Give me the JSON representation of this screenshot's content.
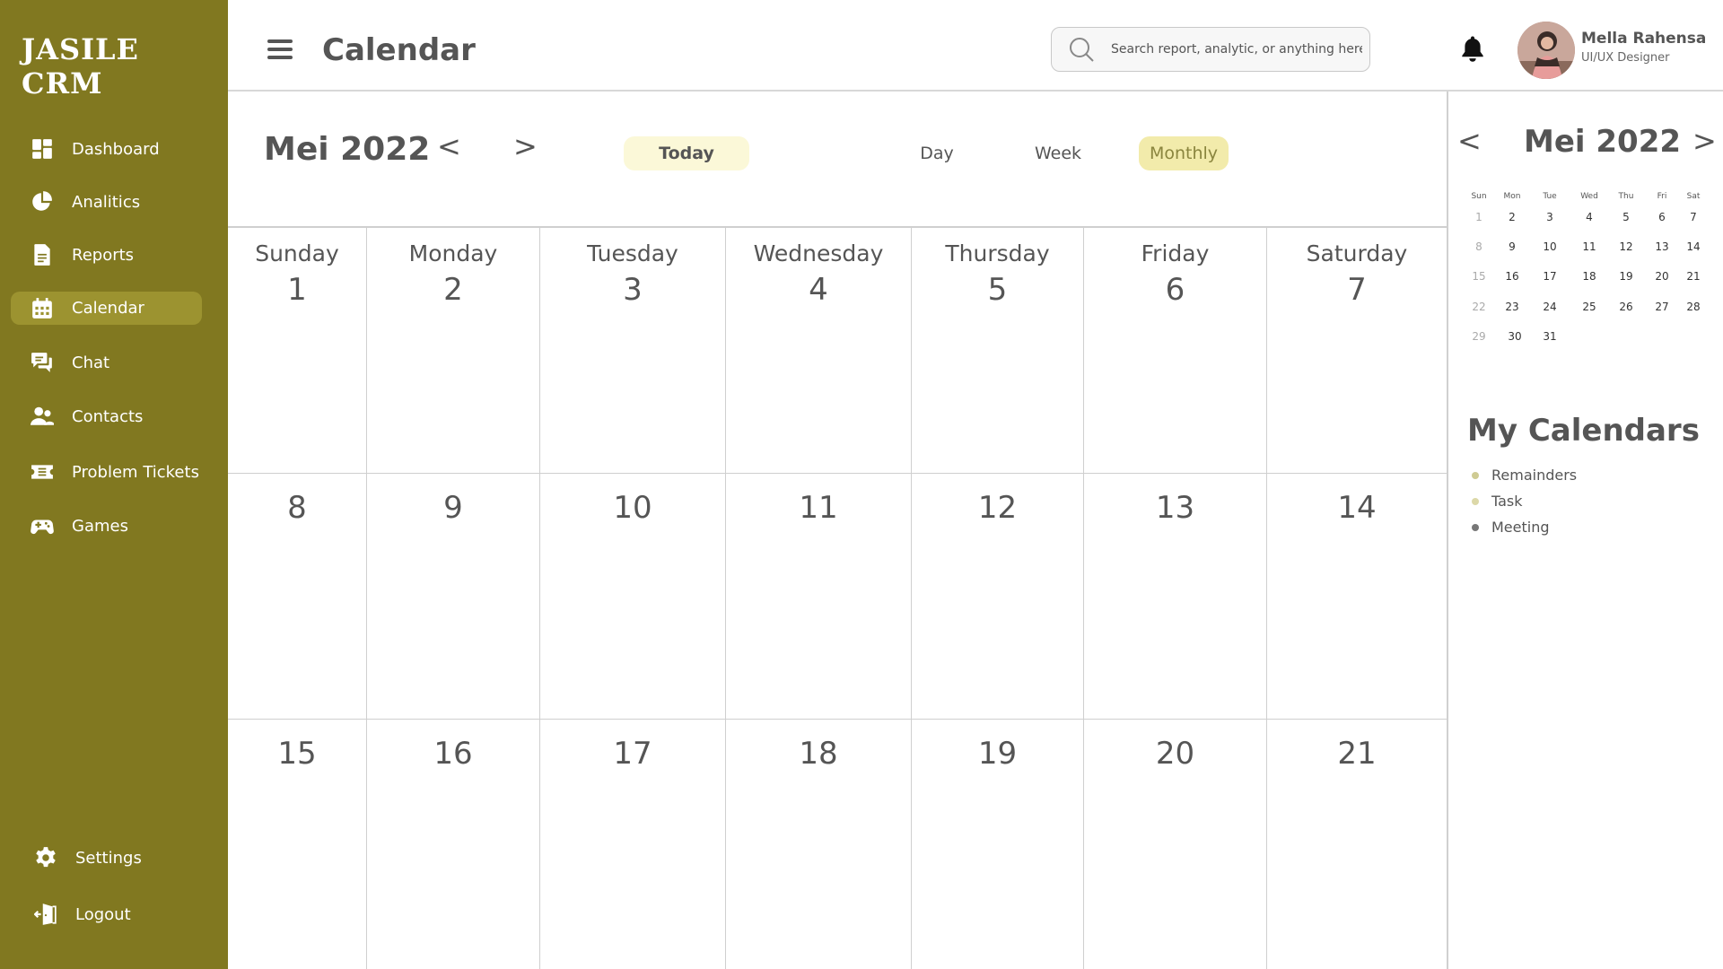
{
  "brand": "JASILE CRM",
  "colors": {
    "sidebar": "#817820",
    "active_item": "#9c9330",
    "today_bg": "#fbf8d8",
    "monthly_bg": "#f2ebab",
    "dot_light": "#d9d5a3",
    "dot_dark": "#777777"
  },
  "sidebar": {
    "items": [
      {
        "label": "Dashboard",
        "icon": "dashboard-icon"
      },
      {
        "label": "Analitics",
        "icon": "pie-chart-icon"
      },
      {
        "label": "Reports",
        "icon": "document-icon"
      },
      {
        "label": "Calendar",
        "icon": "calendar-icon",
        "active": true
      },
      {
        "label": "Chat",
        "icon": "chat-icon"
      },
      {
        "label": "Contacts",
        "icon": "contacts-icon"
      },
      {
        "label": "Problem Tickets",
        "icon": "ticket-icon"
      },
      {
        "label": "Games",
        "icon": "gamepad-icon"
      }
    ],
    "bottom": [
      {
        "label": "Settings",
        "icon": "gear-icon"
      },
      {
        "label": "Logout",
        "icon": "logout-icon"
      }
    ]
  },
  "header": {
    "title": "Calendar",
    "search_placeholder": "Search report, analytic, or anything here",
    "user_name": "Mella Rahensa",
    "user_role": "UI/UX Designer"
  },
  "toolbar": {
    "month": "Mei 2022",
    "prev": "<",
    "next": ">",
    "today": "Today",
    "day": "Day",
    "week": "Week",
    "monthly": "Monthly"
  },
  "calendar": {
    "day_names": [
      "Sunday",
      "Monday",
      "Tuesday",
      "Wednesday",
      "Thursday",
      "Friday",
      "Saturday"
    ],
    "weeks": [
      [
        "1",
        "2",
        "3",
        "4",
        "5",
        "6",
        "7"
      ],
      [
        "8",
        "9",
        "10",
        "11",
        "12",
        "13",
        "14"
      ],
      [
        "15",
        "16",
        "17",
        "18",
        "19",
        "20",
        "21"
      ]
    ]
  },
  "mini_calendar": {
    "month": "Mei 2022",
    "prev": "<",
    "next": ">",
    "headers": [
      "Sun",
      "Mon",
      "Tue",
      "Wed",
      "Thu",
      "Fri",
      "Sat"
    ],
    "weeks": [
      [
        "1",
        "2",
        "3",
        "4",
        "5",
        "6",
        "7"
      ],
      [
        "8",
        "9",
        "10",
        "11",
        "12",
        "13",
        "14"
      ],
      [
        "15",
        "16",
        "17",
        "18",
        "19",
        "20",
        "21"
      ],
      [
        "22",
        "23",
        "24",
        "25",
        "26",
        "27",
        "28"
      ],
      [
        "29",
        "30",
        "31"
      ]
    ]
  },
  "my_calendars": {
    "title": "My Calendars",
    "items": [
      {
        "label": "Remainders",
        "color": "#cfcb93"
      },
      {
        "label": "Task",
        "color": "#dcd8a8"
      },
      {
        "label": "Meeting",
        "color": "#777777"
      }
    ]
  }
}
